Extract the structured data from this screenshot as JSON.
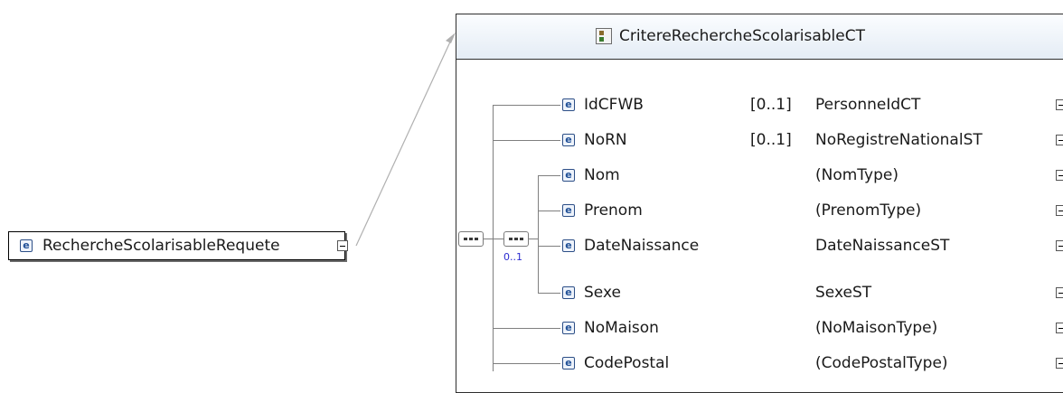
{
  "root_element": {
    "icon": "element-icon",
    "icon_glyph": "e",
    "label": "RechercheScolarisableRequete"
  },
  "complex_type": {
    "icon": "complex-type-icon",
    "title": "CritereRechercheScolarisableCT"
  },
  "choice_group": {
    "icon": "sequence-compositor-icon",
    "occurrence": "0..1"
  },
  "outer_sequence": {
    "icon": "sequence-compositor-icon"
  },
  "rows": [
    {
      "name": "IdCFWB",
      "occurrence": "[0..1]",
      "type": "PersonneIdCT",
      "icon_glyph": "e"
    },
    {
      "name": "NoRN",
      "occurrence": "[0..1]",
      "type": "NoRegistreNationalST",
      "icon_glyph": "e"
    },
    {
      "name": "Nom",
      "occurrence": "",
      "type": "(NomType)",
      "icon_glyph": "e"
    },
    {
      "name": "Prenom",
      "occurrence": "",
      "type": "(PrenomType)",
      "icon_glyph": "e"
    },
    {
      "name": "DateNaissance",
      "occurrence": "",
      "type": "DateNaissanceST",
      "icon_glyph": "e"
    },
    {
      "name": "Sexe",
      "occurrence": "",
      "type": "SexeST",
      "icon_glyph": "e"
    },
    {
      "name": "NoMaison",
      "occurrence": "",
      "type": "(NoMaisonType)",
      "icon_glyph": "e"
    },
    {
      "name": "CodePostal",
      "occurrence": "",
      "type": "(CodePostalType)",
      "icon_glyph": "e"
    }
  ],
  "colors": {
    "icon_blue": "#1f4f96",
    "occurrence_blue": "#2b2bd0",
    "line_gray": "#7f7f7f"
  }
}
